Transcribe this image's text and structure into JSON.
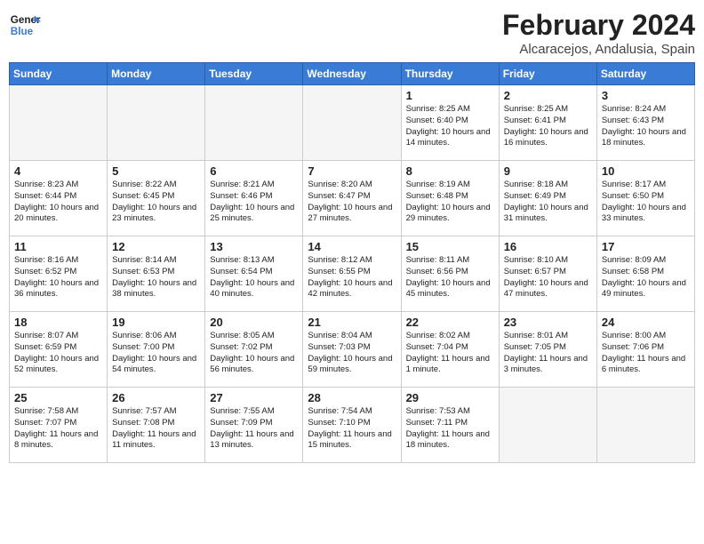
{
  "header": {
    "logo_general": "General",
    "logo_blue": "Blue",
    "month_title": "February 2024",
    "location": "Alcaracejos, Andalusia, Spain"
  },
  "weekdays": [
    "Sunday",
    "Monday",
    "Tuesday",
    "Wednesday",
    "Thursday",
    "Friday",
    "Saturday"
  ],
  "weeks": [
    [
      {
        "day": "",
        "info": ""
      },
      {
        "day": "",
        "info": ""
      },
      {
        "day": "",
        "info": ""
      },
      {
        "day": "",
        "info": ""
      },
      {
        "day": "1",
        "info": "Sunrise: 8:25 AM\nSunset: 6:40 PM\nDaylight: 10 hours and 14 minutes."
      },
      {
        "day": "2",
        "info": "Sunrise: 8:25 AM\nSunset: 6:41 PM\nDaylight: 10 hours and 16 minutes."
      },
      {
        "day": "3",
        "info": "Sunrise: 8:24 AM\nSunset: 6:43 PM\nDaylight: 10 hours and 18 minutes."
      }
    ],
    [
      {
        "day": "4",
        "info": "Sunrise: 8:23 AM\nSunset: 6:44 PM\nDaylight: 10 hours and 20 minutes."
      },
      {
        "day": "5",
        "info": "Sunrise: 8:22 AM\nSunset: 6:45 PM\nDaylight: 10 hours and 23 minutes."
      },
      {
        "day": "6",
        "info": "Sunrise: 8:21 AM\nSunset: 6:46 PM\nDaylight: 10 hours and 25 minutes."
      },
      {
        "day": "7",
        "info": "Sunrise: 8:20 AM\nSunset: 6:47 PM\nDaylight: 10 hours and 27 minutes."
      },
      {
        "day": "8",
        "info": "Sunrise: 8:19 AM\nSunset: 6:48 PM\nDaylight: 10 hours and 29 minutes."
      },
      {
        "day": "9",
        "info": "Sunrise: 8:18 AM\nSunset: 6:49 PM\nDaylight: 10 hours and 31 minutes."
      },
      {
        "day": "10",
        "info": "Sunrise: 8:17 AM\nSunset: 6:50 PM\nDaylight: 10 hours and 33 minutes."
      }
    ],
    [
      {
        "day": "11",
        "info": "Sunrise: 8:16 AM\nSunset: 6:52 PM\nDaylight: 10 hours and 36 minutes."
      },
      {
        "day": "12",
        "info": "Sunrise: 8:14 AM\nSunset: 6:53 PM\nDaylight: 10 hours and 38 minutes."
      },
      {
        "day": "13",
        "info": "Sunrise: 8:13 AM\nSunset: 6:54 PM\nDaylight: 10 hours and 40 minutes."
      },
      {
        "day": "14",
        "info": "Sunrise: 8:12 AM\nSunset: 6:55 PM\nDaylight: 10 hours and 42 minutes."
      },
      {
        "day": "15",
        "info": "Sunrise: 8:11 AM\nSunset: 6:56 PM\nDaylight: 10 hours and 45 minutes."
      },
      {
        "day": "16",
        "info": "Sunrise: 8:10 AM\nSunset: 6:57 PM\nDaylight: 10 hours and 47 minutes."
      },
      {
        "day": "17",
        "info": "Sunrise: 8:09 AM\nSunset: 6:58 PM\nDaylight: 10 hours and 49 minutes."
      }
    ],
    [
      {
        "day": "18",
        "info": "Sunrise: 8:07 AM\nSunset: 6:59 PM\nDaylight: 10 hours and 52 minutes."
      },
      {
        "day": "19",
        "info": "Sunrise: 8:06 AM\nSunset: 7:00 PM\nDaylight: 10 hours and 54 minutes."
      },
      {
        "day": "20",
        "info": "Sunrise: 8:05 AM\nSunset: 7:02 PM\nDaylight: 10 hours and 56 minutes."
      },
      {
        "day": "21",
        "info": "Sunrise: 8:04 AM\nSunset: 7:03 PM\nDaylight: 10 hours and 59 minutes."
      },
      {
        "day": "22",
        "info": "Sunrise: 8:02 AM\nSunset: 7:04 PM\nDaylight: 11 hours and 1 minute."
      },
      {
        "day": "23",
        "info": "Sunrise: 8:01 AM\nSunset: 7:05 PM\nDaylight: 11 hours and 3 minutes."
      },
      {
        "day": "24",
        "info": "Sunrise: 8:00 AM\nSunset: 7:06 PM\nDaylight: 11 hours and 6 minutes."
      }
    ],
    [
      {
        "day": "25",
        "info": "Sunrise: 7:58 AM\nSunset: 7:07 PM\nDaylight: 11 hours and 8 minutes."
      },
      {
        "day": "26",
        "info": "Sunrise: 7:57 AM\nSunset: 7:08 PM\nDaylight: 11 hours and 11 minutes."
      },
      {
        "day": "27",
        "info": "Sunrise: 7:55 AM\nSunset: 7:09 PM\nDaylight: 11 hours and 13 minutes."
      },
      {
        "day": "28",
        "info": "Sunrise: 7:54 AM\nSunset: 7:10 PM\nDaylight: 11 hours and 15 minutes."
      },
      {
        "day": "29",
        "info": "Sunrise: 7:53 AM\nSunset: 7:11 PM\nDaylight: 11 hours and 18 minutes."
      },
      {
        "day": "",
        "info": ""
      },
      {
        "day": "",
        "info": ""
      }
    ]
  ]
}
